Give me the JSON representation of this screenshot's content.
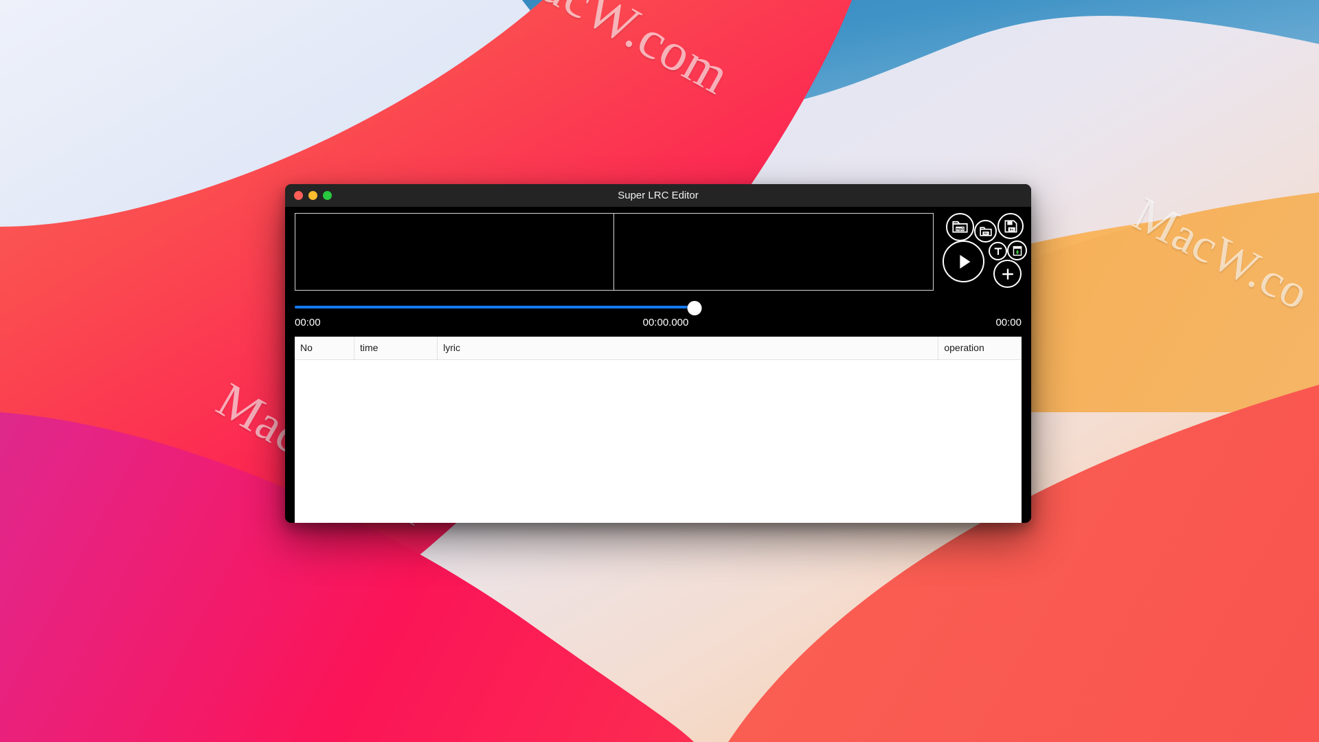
{
  "desktop": {
    "wallpaper_name": "macos-big-sur-gradient",
    "watermarks": [
      {
        "id": "wm-top",
        "text": "MacW.com"
      },
      {
        "id": "wm-right",
        "text": "MacW.co"
      },
      {
        "id": "wm-bottom",
        "text": "MacW.com"
      }
    ],
    "colors": {
      "sky_blue": "#2e80b8",
      "pale_wave": "#dfe6f6",
      "orange": "#f7a43c",
      "coral_red": "#fb4a50",
      "magenta": "#e52485"
    }
  },
  "window": {
    "title": "Super LRC Editor",
    "traffic_lights": [
      {
        "name": "close",
        "color": "#ff5f57"
      },
      {
        "name": "minimize",
        "color": "#febc2e"
      },
      {
        "name": "zoom",
        "color": "#28c840"
      }
    ]
  },
  "lyric_panels": {
    "left_text": "",
    "right_text": ""
  },
  "controls": {
    "open_mp3": {
      "icon": "folder-mp3-icon",
      "label": "mp3"
    },
    "open_lrc": {
      "icon": "folder-lrc-icon",
      "label": "lrc"
    },
    "save_lrc": {
      "icon": "save-floppy-lrc-icon",
      "label": "lrc"
    },
    "play": {
      "icon": "play-icon",
      "label": ""
    },
    "text": {
      "icon": "text-t-icon",
      "label": "T"
    },
    "delete": {
      "icon": "trash-recycle-icon",
      "label": ""
    },
    "add": {
      "icon": "plus-icon",
      "label": "+"
    }
  },
  "player": {
    "current_time": "00:00",
    "precise_time": "00:00.000",
    "total_time": "00:00",
    "progress_percent": 55,
    "track_color": "#147bf0",
    "thumb_color": "#ffffff"
  },
  "lyric_table": {
    "columns": [
      {
        "key": "no",
        "label": "No"
      },
      {
        "key": "time",
        "label": "time"
      },
      {
        "key": "lyric",
        "label": "lyric"
      },
      {
        "key": "operation",
        "label": "operation"
      }
    ],
    "rows": []
  }
}
